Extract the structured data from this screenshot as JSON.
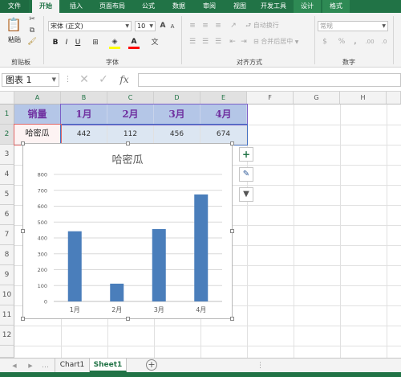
{
  "ribbon_tabs": [
    "文件",
    "开始",
    "插入",
    "页面布局",
    "公式",
    "数据",
    "审阅",
    "视图",
    "开发工具",
    "设计",
    "格式"
  ],
  "active_tab": "开始",
  "clipboard": {
    "paste_label": "粘贴",
    "group_label": "剪贴板"
  },
  "font": {
    "name": "宋体 (正文)",
    "size": "10",
    "group_label": "字体",
    "bold": "B",
    "italic": "I",
    "underline": "U",
    "grow": "A",
    "shrink": "A",
    "fill_color": "#ffff00",
    "font_color": "#ff0000"
  },
  "alignment": {
    "wrap_label": "自动换行",
    "merge_label": "合并后居中",
    "group_label": "对齐方式"
  },
  "number": {
    "format": "常规",
    "percent": "%",
    "comma": ",",
    "group_label": "数字"
  },
  "formula_bar": {
    "name_box": "图表 1",
    "fx": "fx"
  },
  "columns": [
    "A",
    "B",
    "C",
    "D",
    "E",
    "F",
    "G",
    "H"
  ],
  "rows": [
    "1",
    "2",
    "3",
    "4",
    "5",
    "6",
    "7",
    "8",
    "9",
    "10",
    "11",
    "12"
  ],
  "table": {
    "headers": [
      "销量",
      "1月",
      "2月",
      "3月",
      "4月"
    ],
    "row": [
      "哈密瓜",
      "442",
      "112",
      "456",
      "674"
    ]
  },
  "chart_data": {
    "type": "bar",
    "title": "哈密瓜",
    "categories": [
      "1月",
      "2月",
      "3月",
      "4月"
    ],
    "values": [
      442,
      112,
      456,
      674
    ],
    "xlabel": "",
    "ylabel": "",
    "ylim": [
      0,
      800
    ],
    "yticks": [
      "0",
      "100",
      "200",
      "300",
      "400",
      "500",
      "600",
      "700",
      "800"
    ],
    "grid": true,
    "bar_color": "#4a7ebb"
  },
  "chart_buttons": {
    "add": "+",
    "style": "✎",
    "filter": "▼"
  },
  "sheet_tabs": [
    "Chart1",
    "Sheet1"
  ],
  "active_sheet": "Sheet1",
  "colors": {
    "accent": "#217346",
    "header_fill": "#b4c6e7",
    "header_text": "#7030a0",
    "value_fill": "#dce6f2"
  }
}
